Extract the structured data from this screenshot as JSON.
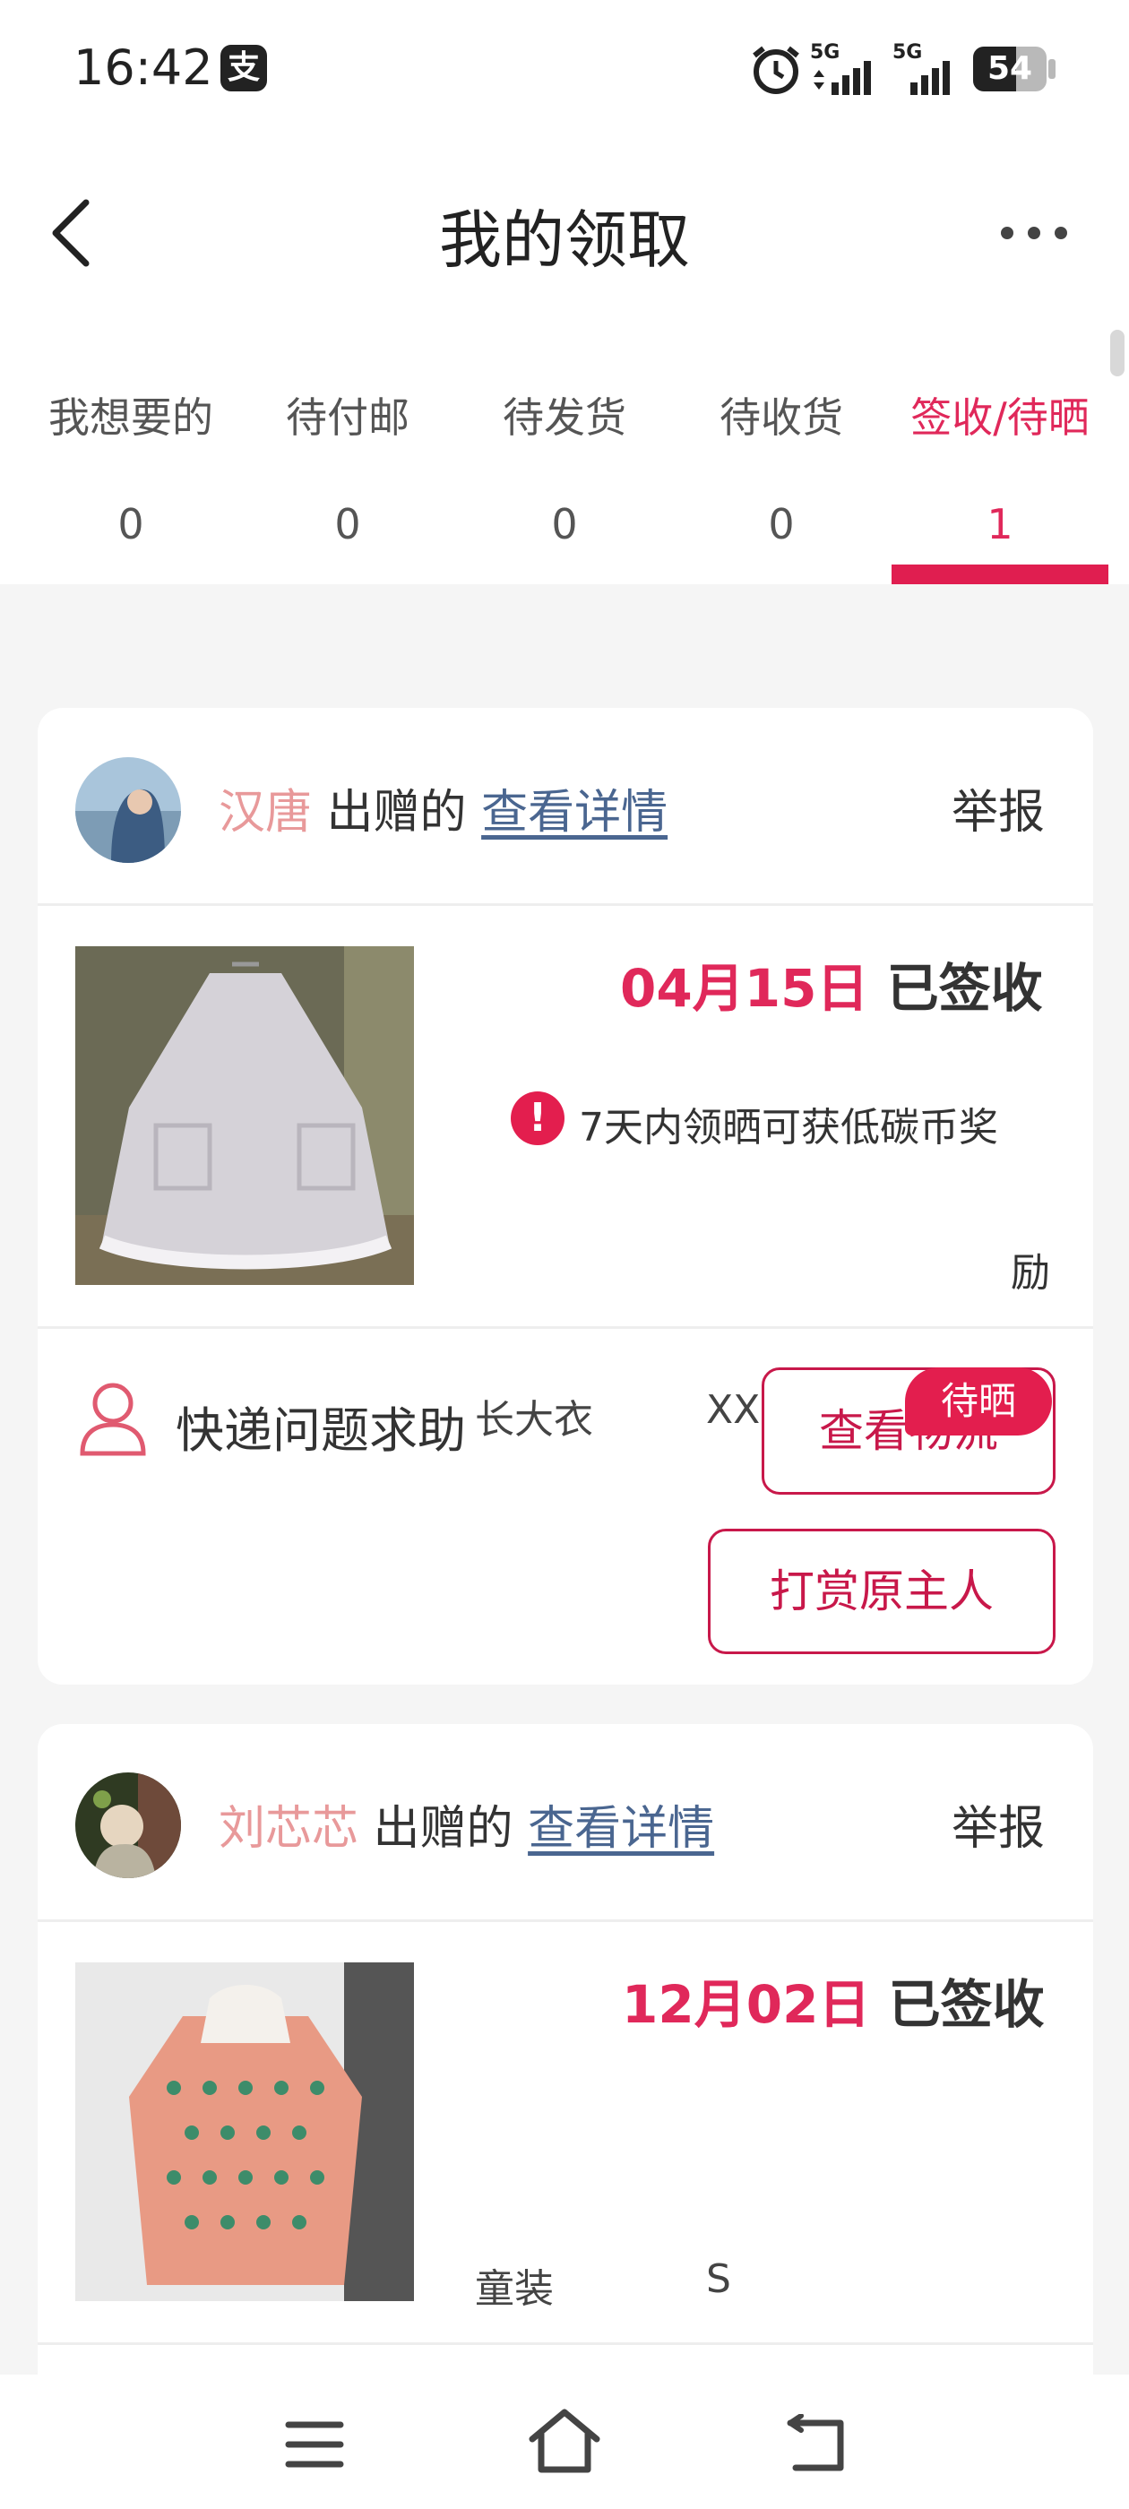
{
  "status_bar": {
    "time": "16:42",
    "notification_icon": "app-notification-icon",
    "signal_label_1": "5G",
    "signal_label_2": "5G",
    "battery": "54"
  },
  "header": {
    "title": "我的领取",
    "back_icon": "back-arrow-icon",
    "more_icon": "more-dots-icon"
  },
  "tabs": [
    {
      "label": "我想要的",
      "count": "0",
      "active": false
    },
    {
      "label": "待付邮",
      "count": "0",
      "active": false
    },
    {
      "label": "待发货",
      "count": "0",
      "active": false
    },
    {
      "label": "待收货",
      "count": "0",
      "active": false
    },
    {
      "label": "签收/待晒",
      "count": "1",
      "active": true
    }
  ],
  "accent_color": "#e0285a",
  "cards": [
    {
      "donor": "汉唐",
      "gave_text": "出赠的",
      "detail_link": "查看详情",
      "report": "举报",
      "date": "04月15日",
      "status": "已签收",
      "notice_line1": "7天内领晒可获低碳币奖",
      "notice_line2": "励",
      "category": "长大衣",
      "size": "XXL",
      "help_text": "快递问题求助",
      "logistics_button": "查看物流",
      "badge": "待晒",
      "reward_button": "打赏原主人"
    },
    {
      "donor": "刘芯芯",
      "gave_text": "出赠的",
      "detail_link": "查看详情",
      "report": "举报",
      "date": "12月02日",
      "status": "已签收",
      "category": "童装",
      "size": "S"
    }
  ],
  "nav": {
    "menu_icon": "menu-icon",
    "home_icon": "home-icon",
    "back_icon": "back-nav-icon"
  }
}
